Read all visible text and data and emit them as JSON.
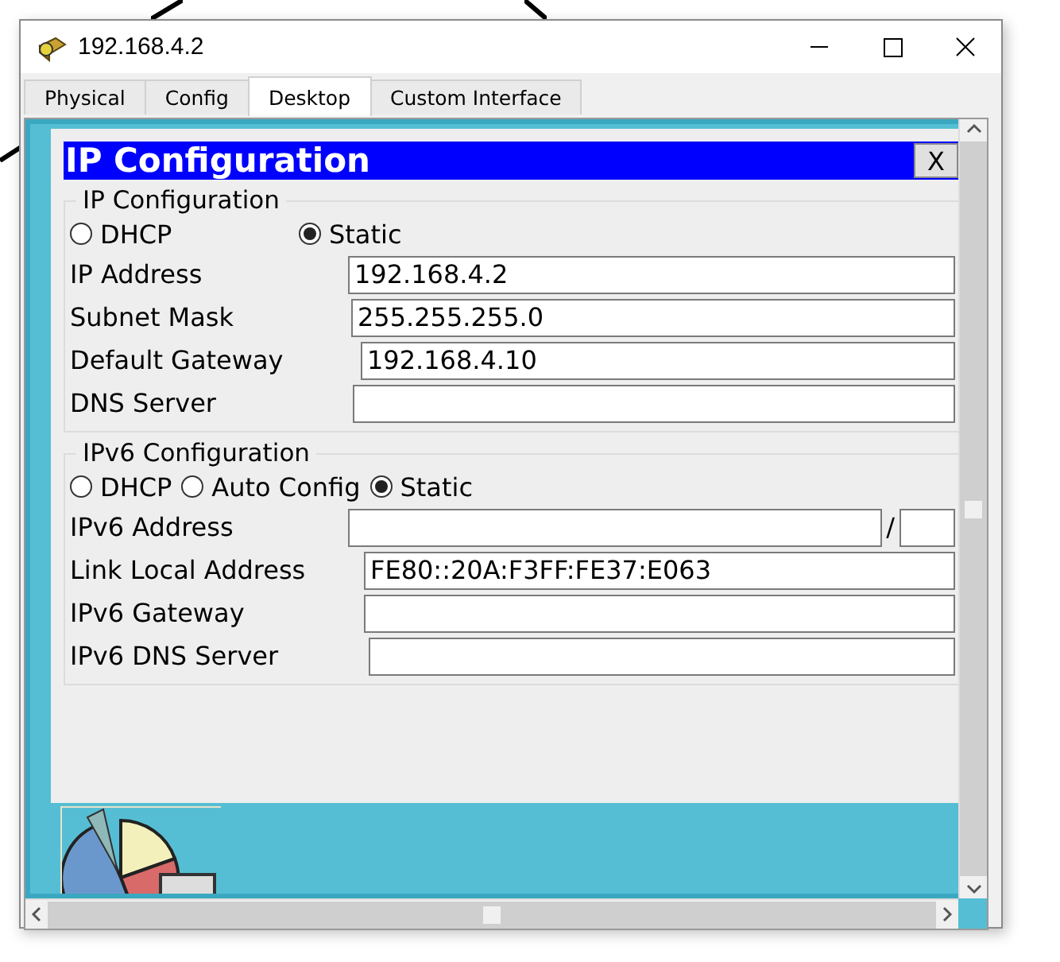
{
  "window": {
    "title": "192.168.4.2"
  },
  "tabs": [
    {
      "label": "Physical",
      "selected": false
    },
    {
      "label": "Config",
      "selected": false
    },
    {
      "label": "Desktop",
      "selected": true
    },
    {
      "label": "Custom Interface",
      "selected": false
    }
  ],
  "dialog": {
    "title": "IP Configuration",
    "close_label": "X",
    "ipv4": {
      "legend": "IP Configuration",
      "modes": [
        {
          "label": "DHCP",
          "selected": false
        },
        {
          "label": "Static",
          "selected": true
        }
      ],
      "fields": [
        {
          "label": "IP Address",
          "value": "192.168.4.2"
        },
        {
          "label": "Subnet Mask",
          "value": "255.255.255.0"
        },
        {
          "label": "Default Gateway",
          "value": "192.168.4.10"
        },
        {
          "label": "DNS Server"
        }
      ]
    },
    "ipv6": {
      "legend": "IPv6 Configuration",
      "modes": [
        {
          "label": "DHCP",
          "selected": false
        },
        {
          "label": "Auto Config",
          "selected": false
        },
        {
          "label": "Static",
          "selected": true
        }
      ],
      "fields": [
        {
          "label": "IPv6 Address",
          "kind": "prefixed",
          "separator": "/"
        },
        {
          "label": "Link Local Address",
          "value": "FE80::20A:F3FF:FE37:E063",
          "kind": "plain"
        },
        {
          "label": "IPv6 Gateway",
          "kind": "plain"
        },
        {
          "label": "IPv6 DNS Server",
          "kind": "plain"
        }
      ]
    }
  }
}
